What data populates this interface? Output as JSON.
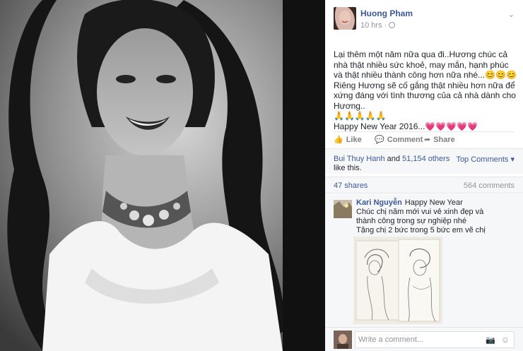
{
  "post": {
    "author": "Huong Pham",
    "time": "10 hrs",
    "separator": "·",
    "body_lines": [
      "Lại thêm một năm nữa qua đi..Hương chúc cả nhà thật nhiều sức khoẻ, may mắn, hạnh phúc và thật nhiều thành công hơn nữa nhé...😊😊😊 Riêng Hương sẽ cố gắng thật nhiều hơn nữa để xứng đáng với tình thương của cả nhà dành cho Hương..",
      "🙏🙏🙏🙏🙏",
      "Happy New Year 2016...💗💗💗💗💗"
    ]
  },
  "actions": {
    "like": "Like",
    "comment": "Comment",
    "share": "Share"
  },
  "reactions": {
    "liker": "Bui Thuy Hanh",
    "and_text": " and ",
    "others": "51,154 others",
    "suffix": " like this.",
    "top_comments": "Top Comments ▾"
  },
  "counts": {
    "shares": "47 shares",
    "comments": "564 comments"
  },
  "comment": {
    "name": "Kari Nguyễn",
    "first_text": "Happy New Year",
    "lines": [
      "Chúc chị năm mới vui vẻ xinh đẹp và thành công trong sự nghiệp nhé",
      "Tặng chị 2 bức trong 5 bức em vẽ chị"
    ]
  },
  "composer": {
    "placeholder": "Write a comment..."
  },
  "colors": {
    "link": "#3b5998",
    "muted": "#90949c",
    "panel": "#f6f7f9"
  }
}
